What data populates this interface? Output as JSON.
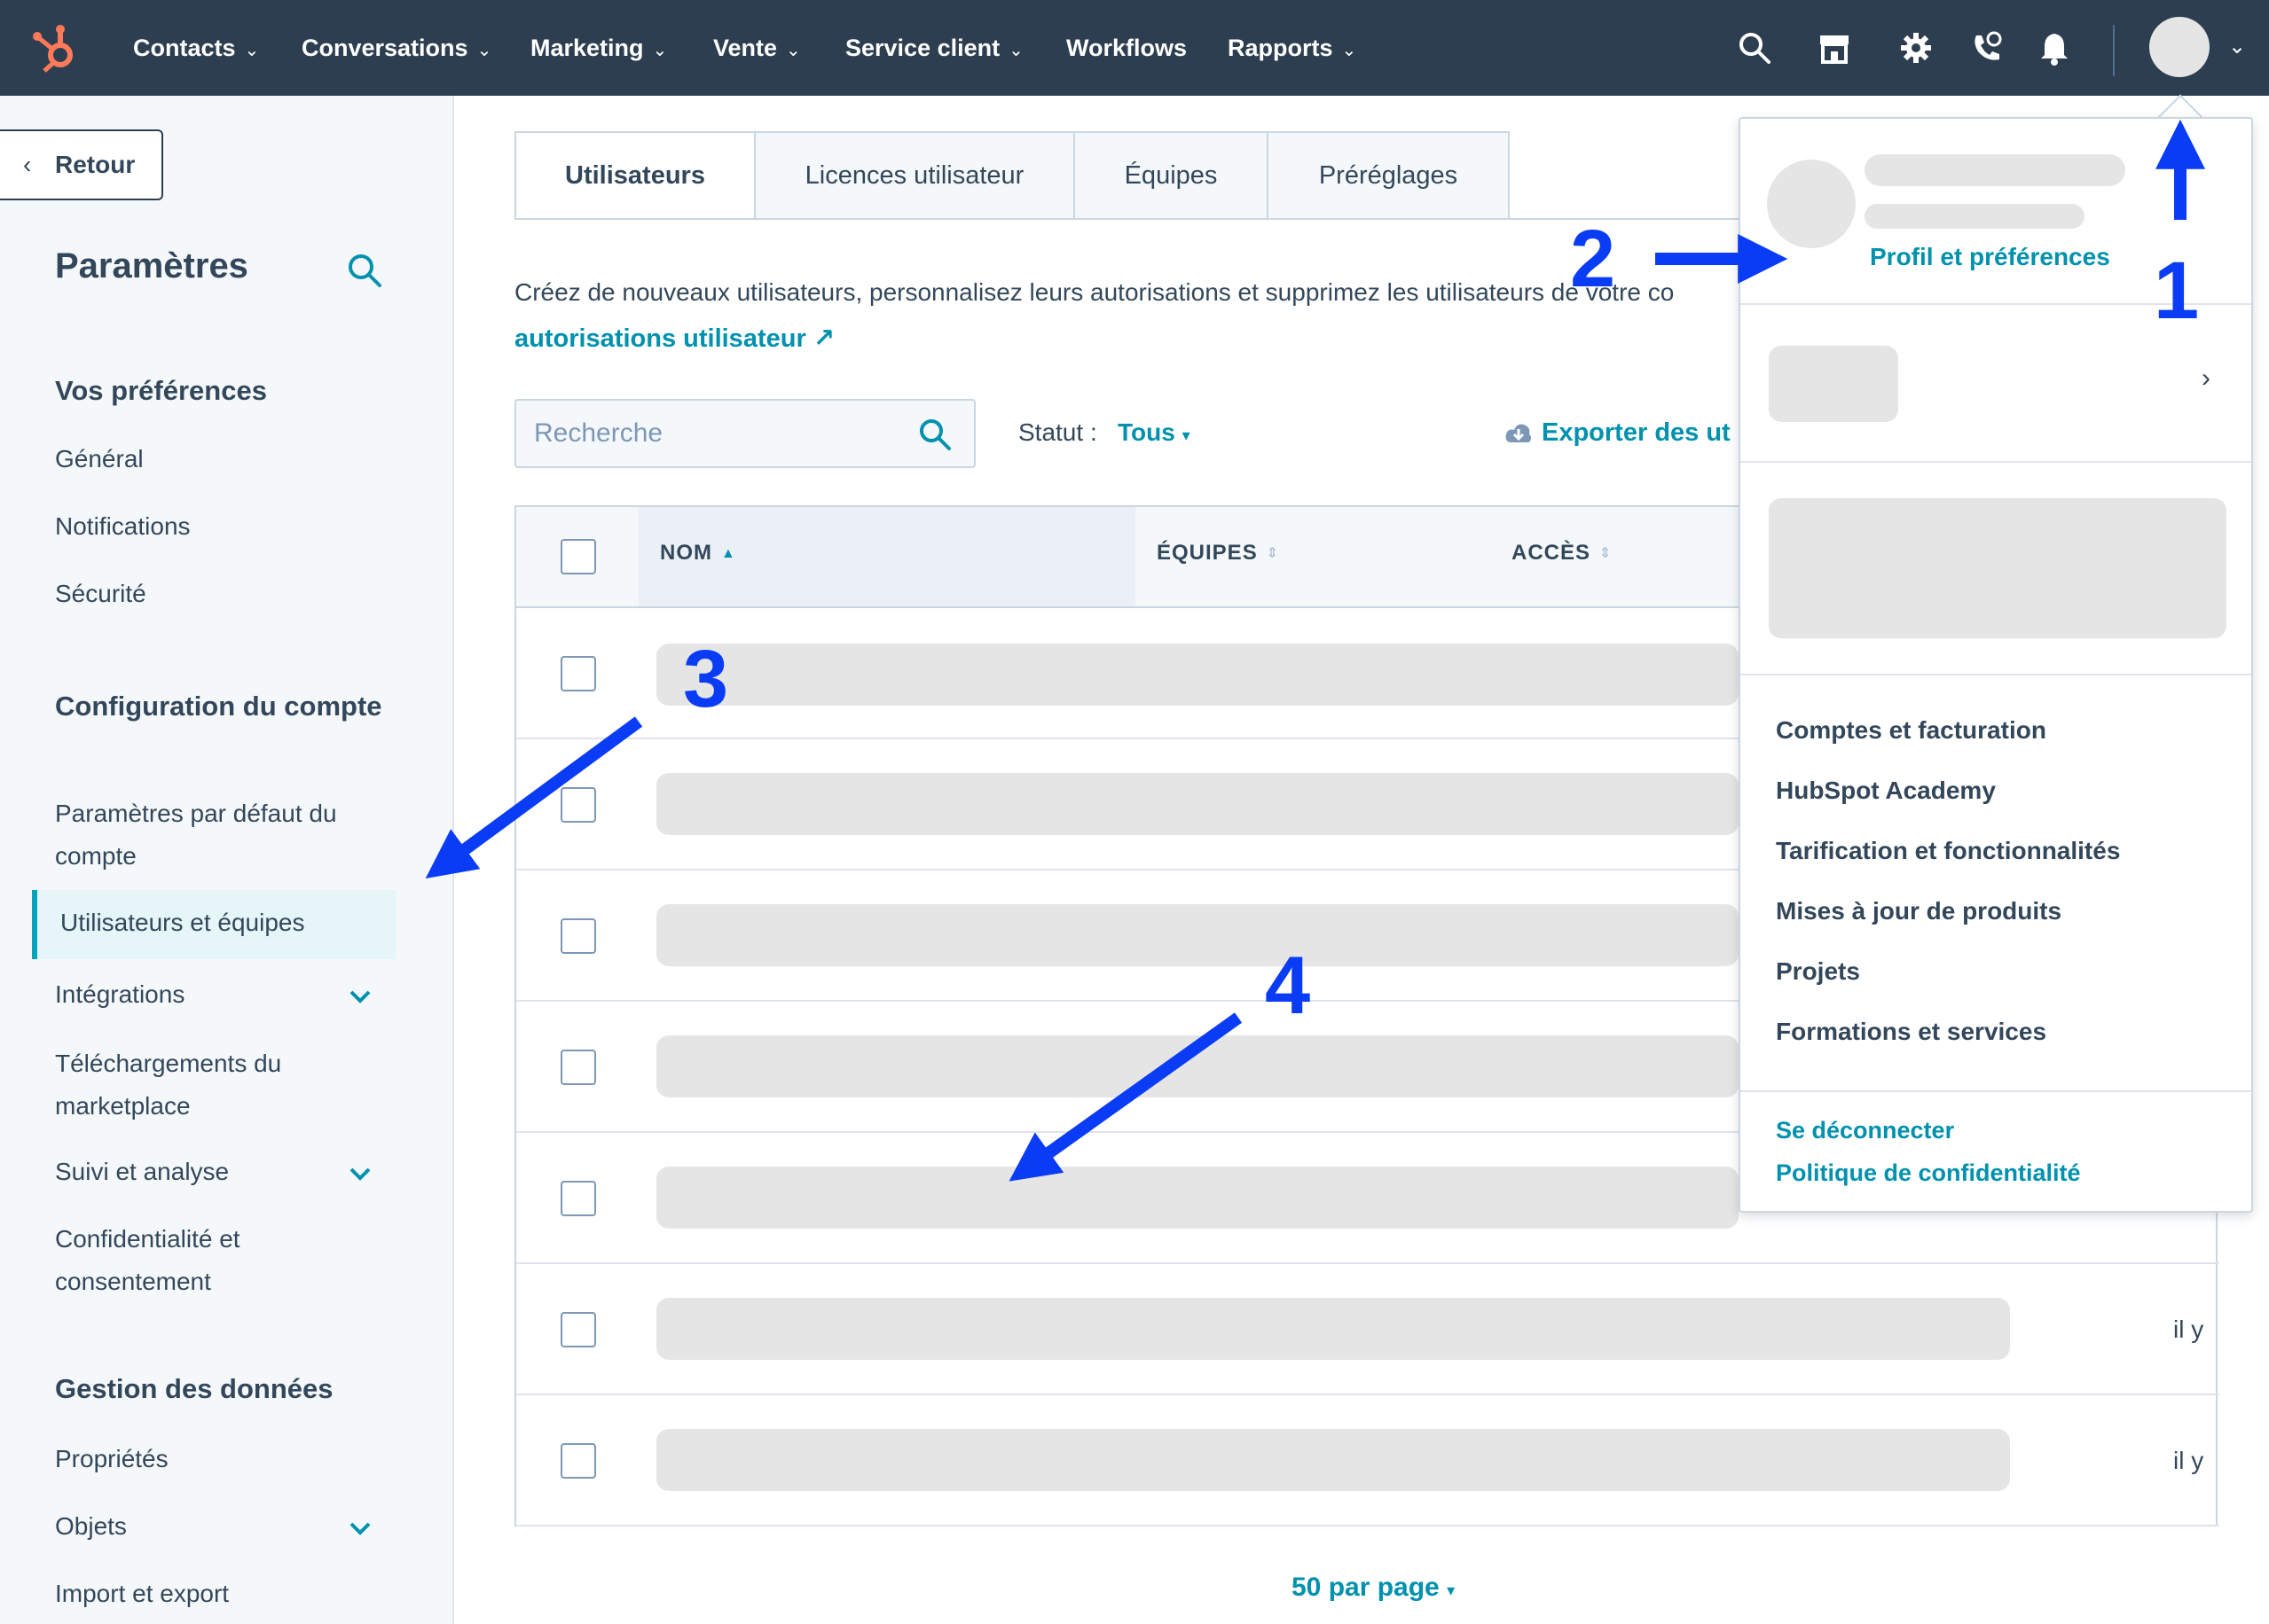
{
  "colors": {
    "nav_bg": "#2d3e50",
    "accent_link": "#0091ae",
    "brand_orange": "#ff7a59",
    "active_border": "#00a4bd",
    "annotation_blue": "#0a3cf5"
  },
  "topnav": {
    "logo_icon": "hubspot-sprocket-icon",
    "items": [
      {
        "label": "Contacts",
        "has_dropdown": true
      },
      {
        "label": "Conversations",
        "has_dropdown": true
      },
      {
        "label": "Marketing",
        "has_dropdown": true
      },
      {
        "label": "Vente",
        "has_dropdown": true
      },
      {
        "label": "Service client",
        "has_dropdown": true
      },
      {
        "label": "Workflows",
        "has_dropdown": false
      },
      {
        "label": "Rapports",
        "has_dropdown": true
      }
    ],
    "icons": [
      "search-icon",
      "marketplace-icon",
      "gear-icon",
      "calling-icon",
      "bell-icon"
    ],
    "chevron": "⌄"
  },
  "sidebar": {
    "back_label": "Retour",
    "title": "Paramètres",
    "sections": [
      {
        "heading": "Vos préférences",
        "items": [
          "Général",
          "Notifications",
          "Sécurité"
        ]
      },
      {
        "heading": "Configuration du compte",
        "items": [
          "Paramètres par défaut du compte",
          "Utilisateurs et équipes",
          "Intégrations",
          "Téléchargements du marketplace",
          "Suivi et analyse",
          "Confidentialité et consentement"
        ]
      },
      {
        "heading": "Gestion des données",
        "items": [
          "Propriétés",
          "Objets",
          "Import et export"
        ]
      }
    ],
    "active_item": "Utilisateurs et équipes"
  },
  "tabs": [
    "Utilisateurs",
    "Licences utilisateur",
    "Équipes",
    "Préréglages"
  ],
  "active_tab": "Utilisateurs",
  "description": "Créez de nouveaux utilisateurs, personnalisez leurs autorisations et supprimez les utilisateurs de votre co",
  "description_link": "autorisations utilisateur",
  "search": {
    "placeholder": "Recherche"
  },
  "filter": {
    "label": "Statut :",
    "value": "Tous"
  },
  "export_label": "Exporter des ut",
  "table": {
    "columns": [
      "NOM",
      "ÉQUIPES",
      "ACCÈS"
    ],
    "row_count": 7,
    "time_text": "il y"
  },
  "pagination": {
    "per_page": "50 par page"
  },
  "dropdown": {
    "profile_link": "Profil et préférences",
    "menu_items": [
      "Comptes et facturation",
      "HubSpot Academy",
      "Tarification et fonctionnalités",
      "Mises à jour de produits",
      "Projets",
      "Formations et services"
    ],
    "footer_links": [
      "Se déconnecter",
      "Politique de confidentialité"
    ]
  },
  "annotations": [
    "1",
    "2",
    "3",
    "4"
  ]
}
